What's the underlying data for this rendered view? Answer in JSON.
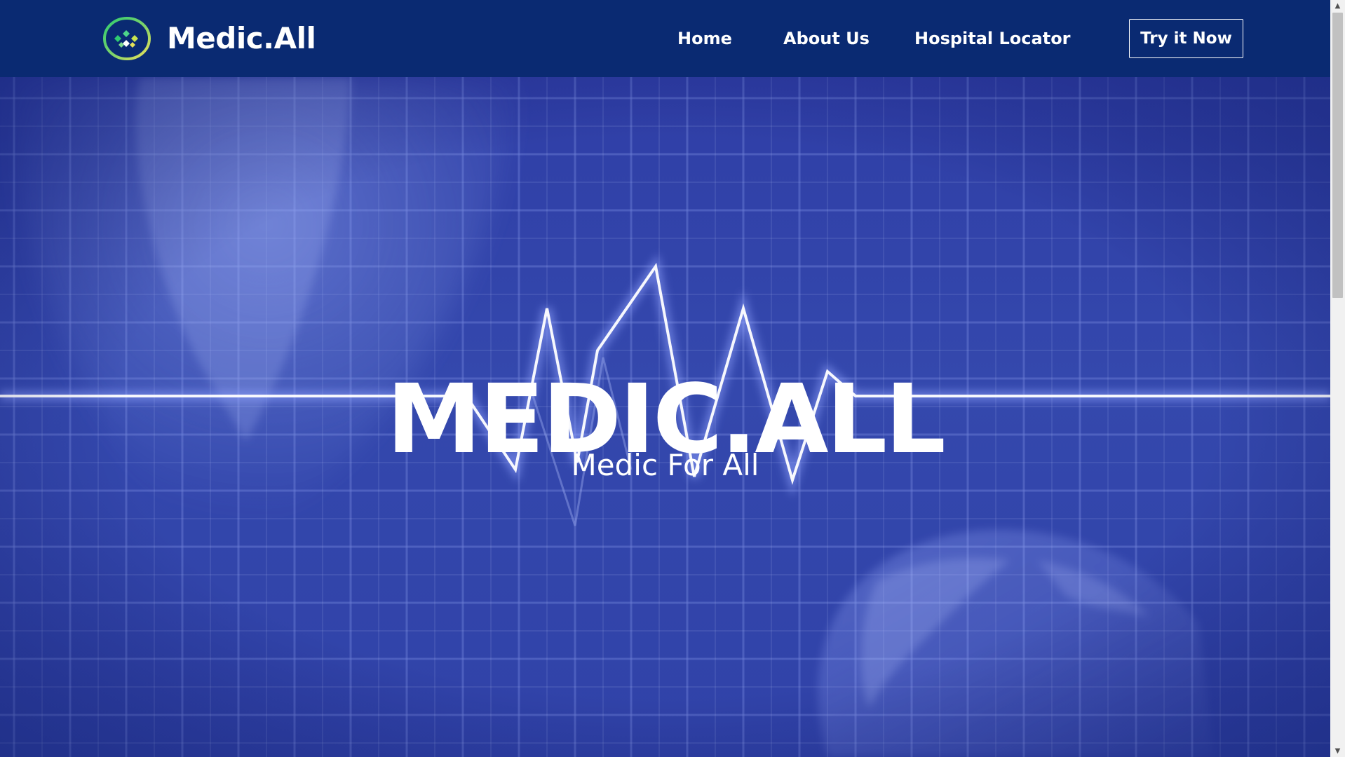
{
  "brand": {
    "name": "Medic.All",
    "logo_icon": "medic-all-logo-icon"
  },
  "nav": {
    "items": [
      {
        "label": "Home"
      },
      {
        "label": "About Us"
      },
      {
        "label": "Hospital Locator"
      }
    ],
    "cta_label": "Try it Now"
  },
  "hero": {
    "title": "MEDIC.ALL",
    "subtitle": "Medic For All",
    "background": "heartbeat-monitor-grid-image"
  },
  "colors": {
    "navbar": "#0a2a72",
    "hero": "#3448ad",
    "text": "#ffffff",
    "logo_ring_gradient": [
      "#2ecc71",
      "#f1e05a"
    ]
  },
  "scrollbar": {
    "up_arrow": "▲",
    "down_arrow": "▼"
  }
}
